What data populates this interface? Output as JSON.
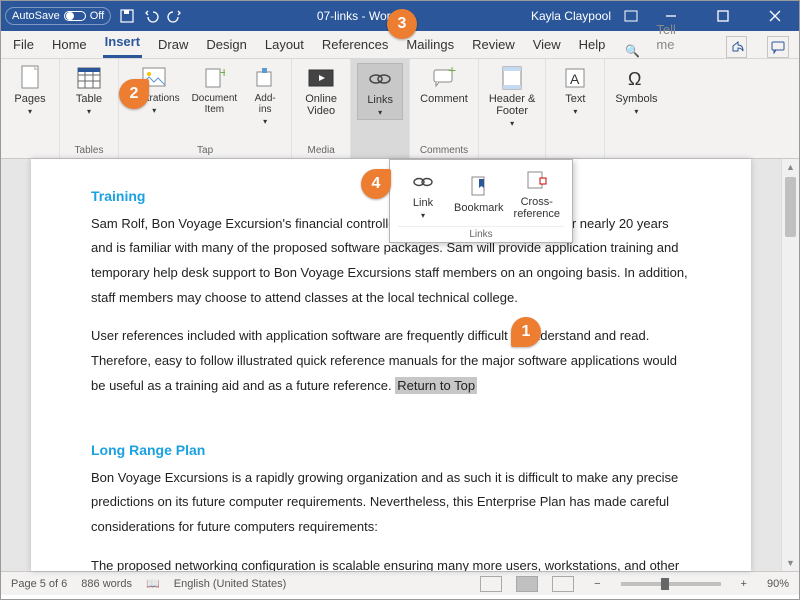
{
  "titlebar": {
    "autosave": "AutoSave",
    "off": "Off",
    "docname": "07-links - Word",
    "user": "Kayla Claypool"
  },
  "tabs": {
    "file": "File",
    "home": "Home",
    "insert": "Insert",
    "draw": "Draw",
    "design": "Design",
    "layout": "Layout",
    "references": "References",
    "mailings": "Mailings",
    "review": "Review",
    "view": "View",
    "help": "Help",
    "tellme": "Tell me"
  },
  "ribbon": {
    "pages": {
      "btn": "Pages"
    },
    "tables": {
      "btn": "Table",
      "label": "Tables"
    },
    "illus": {
      "btn": "Illustrations",
      "docitem": "Document\nItem",
      "addins": "Add-\nins",
      "label": "Tap"
    },
    "media": {
      "btn": "Online\nVideo",
      "label": "Media"
    },
    "links": {
      "btn": "Links"
    },
    "comments": {
      "btn": "Comment",
      "label": "Comments"
    },
    "hf": {
      "btn": "Header &\nFooter"
    },
    "text": {
      "btn": "Text"
    },
    "symbols": {
      "btn": "Symbols"
    }
  },
  "dropdown": {
    "link": "Link",
    "bookmark": "Bookmark",
    "crossref": "Cross-\nreference",
    "label": "Links"
  },
  "doc": {
    "h1": "Training",
    "p1a": "Sam Rolf, Bon Voyage Excursion's financial controller, has been a computer user for nearly 20 years and is familiar with many of the proposed software packages. Sam will provide application training and temporary help desk support to Bon Voyage Excursions staff members on an ongoing basis. In addition, staff members may choose to attend classes at the local technical college.",
    "p2": "User references included with application software are frequently difficult to understand and read. Therefore, easy to follow illustrated quick reference manuals for the major software applications would be useful as a training aid and as a future reference. ",
    "rlink": "Return to Top",
    "h2": "Long Range Plan",
    "p3": "Bon Voyage Excursions is a rapidly growing organization and as such it is difficult to make any precise predictions on its future computer requirements. Nevertheless, this Enterprise Plan has made careful considerations for future computers requirements:",
    "p4": "The proposed networking configuration is scalable ensuring many more users, workstations, and other technologies can be easily added to the network."
  },
  "status": {
    "page": "Page 5 of 6",
    "words": "886 words",
    "lang": "English (United States)",
    "zoom": "90%"
  },
  "callouts": {
    "c1": "1",
    "c2": "2",
    "c3": "3",
    "c4": "4"
  }
}
